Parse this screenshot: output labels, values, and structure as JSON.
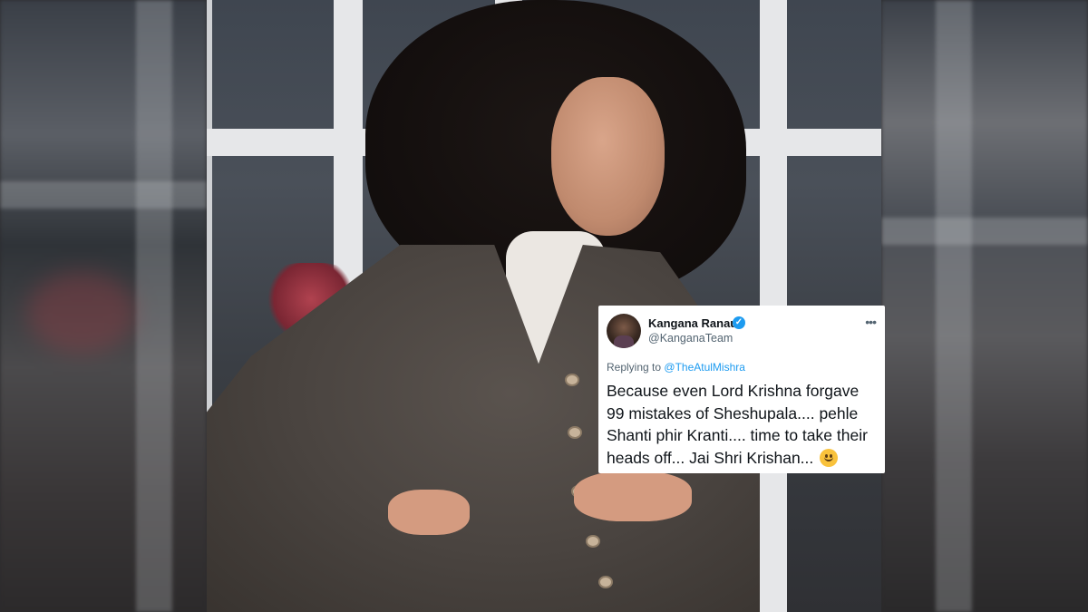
{
  "tweet": {
    "display_name": "Kangana Ranaut",
    "handle": "@KanganaTeam",
    "replying_prefix": "Replying to",
    "replying_to": "@TheAtulMishra",
    "text": "Because even Lord Krishna forgave 99 mistakes of Sheshupala.... pehle Shanti phir Kranti.... time to take their heads off... Jai Shri Krishan...",
    "verified_icon": "verified-badge-icon",
    "more_icon": "more-options-icon",
    "emoji": "slightly-smiling-face",
    "accent_color": "#1d9bf0"
  }
}
